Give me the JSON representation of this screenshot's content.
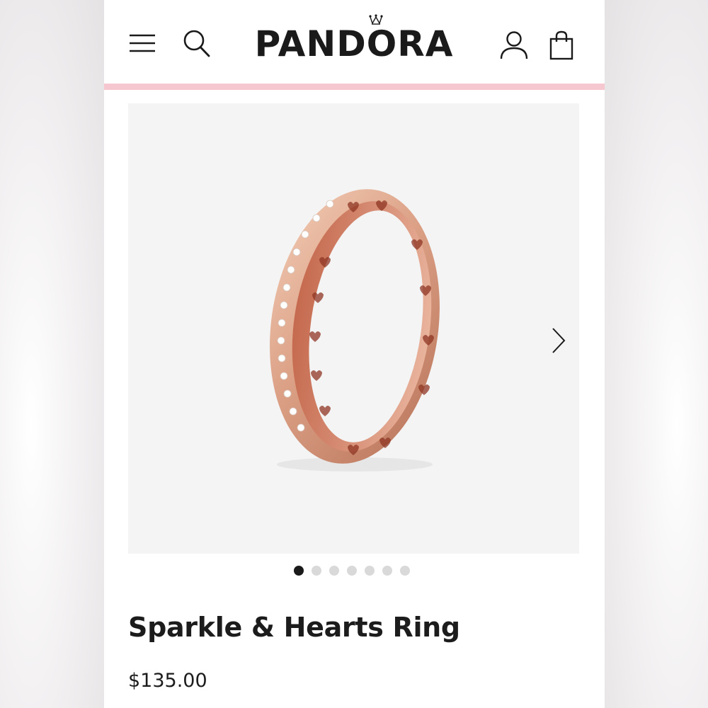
{
  "header": {
    "brand": "PANDORA",
    "icons": {
      "menu": "hamburger-menu-icon",
      "search": "search-icon",
      "account": "account-icon",
      "bag": "shopping-bag-icon"
    },
    "accent_color": "#f6c7cf"
  },
  "gallery": {
    "image": "ring-product-image",
    "next_icon": "chevron-right-icon",
    "image_count": 7,
    "active_index": 0
  },
  "product": {
    "title": "Sparkle & Hearts Ring",
    "price": "$135.00"
  }
}
